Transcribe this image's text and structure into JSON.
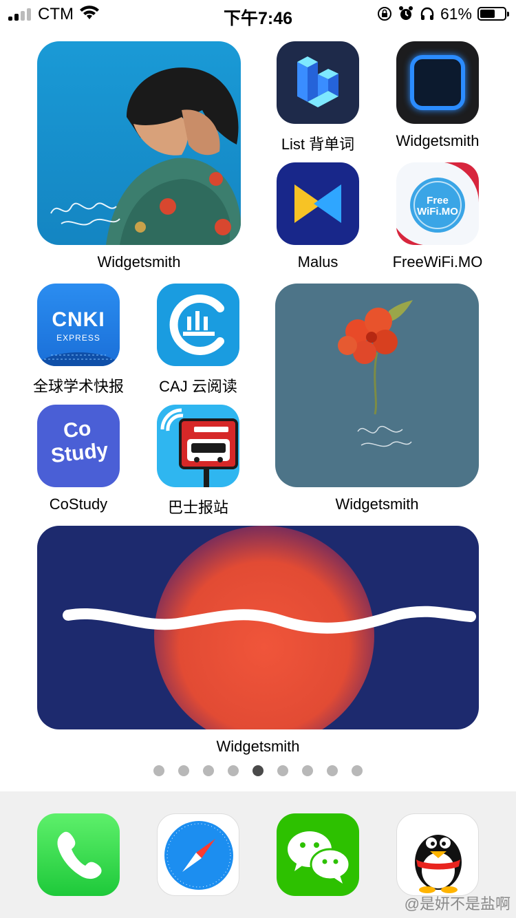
{
  "status_bar": {
    "carrier": "CTM",
    "time": "下午7:46",
    "battery_percent": "61%",
    "battery_level": 0.61
  },
  "home": {
    "widget_top_left": {
      "label": "Widgetsmith"
    },
    "apps": [
      {
        "label": "List 背单词",
        "icon": "cube-icon"
      },
      {
        "label": "Widgetsmith",
        "icon": "widgetsmith-icon"
      },
      {
        "label": "Malus",
        "icon": "malus-icon"
      },
      {
        "label": "FreeWiFi.MO",
        "icon": "freewifi-icon",
        "icon_text": "Free WiFi.MO"
      },
      {
        "label": "全球学术快报",
        "icon": "cnki-icon",
        "icon_text": "CNKI",
        "icon_subtext": "EXPRESS"
      },
      {
        "label": "CAJ 云阅读",
        "icon": "caj-icon"
      },
      {
        "label": "CoStudy",
        "icon": "costudy-icon",
        "icon_text": "Co Study"
      },
      {
        "label": "巴士报站",
        "icon": "bus-stop-icon"
      }
    ],
    "widget_mid_right": {
      "label": "Widgetsmith"
    },
    "widget_wide": {
      "label": "Widgetsmith"
    }
  },
  "page_dots": {
    "count": 9,
    "active_index": 4
  },
  "dock": [
    {
      "name": "phone",
      "icon": "phone-icon"
    },
    {
      "name": "safari",
      "icon": "compass-icon"
    },
    {
      "name": "wechat",
      "icon": "chat-bubbles-icon"
    },
    {
      "name": "qq",
      "icon": "penguin-icon"
    }
  ],
  "watermark": "@是妍不是盐啊"
}
